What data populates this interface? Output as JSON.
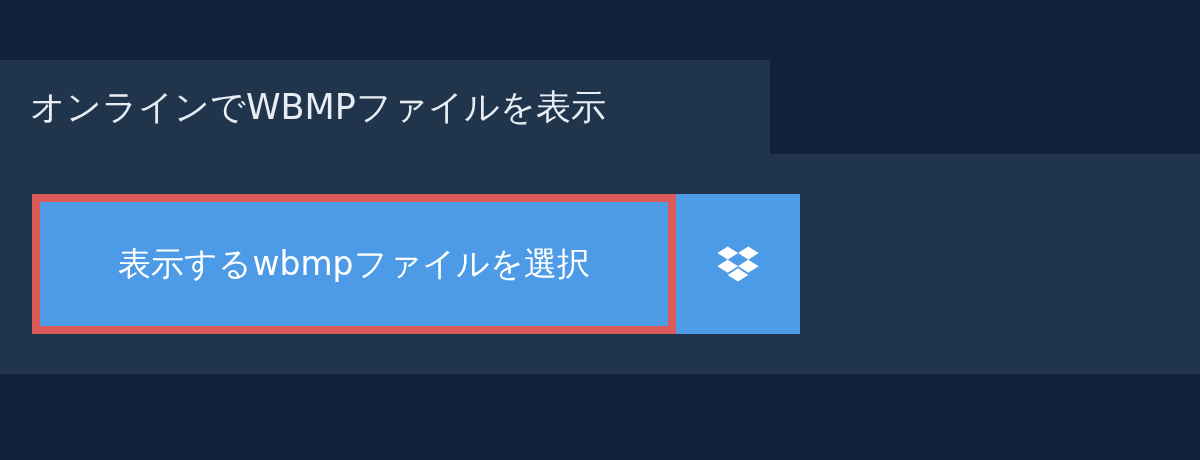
{
  "header": {
    "title": "オンラインでWBMPファイルを表示"
  },
  "upload": {
    "button": "表示するwbmpファイルを選択",
    "focused": true
  }
}
